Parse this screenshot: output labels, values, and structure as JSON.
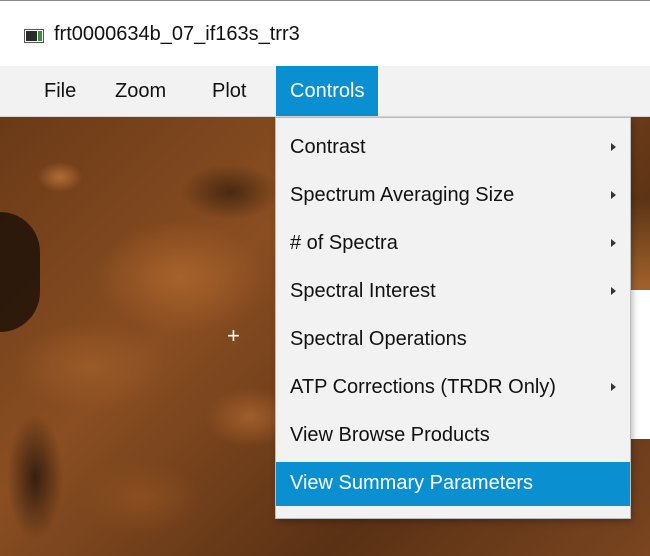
{
  "window": {
    "title": "frt0000634b_07_if163s_trr3",
    "icon": "window-app-icon"
  },
  "menubar": {
    "items": [
      {
        "label": "File"
      },
      {
        "label": "Zoom"
      },
      {
        "label": "Plot"
      },
      {
        "label": "Controls"
      }
    ],
    "active": "Controls",
    "accent_color": "#0a90d0"
  },
  "controls_menu": {
    "items": [
      {
        "label": "Contrast",
        "has_submenu": true
      },
      {
        "label": "Spectrum Averaging Size",
        "has_submenu": true
      },
      {
        "label": "# of Spectra",
        "has_submenu": true
      },
      {
        "label": "Spectral Interest",
        "has_submenu": true
      },
      {
        "label": "Spectral Operations",
        "has_submenu": false
      },
      {
        "label": "ATP Corrections (TRDR Only)",
        "has_submenu": true
      },
      {
        "label": "View Browse Products",
        "has_submenu": false
      },
      {
        "label": "View Summary Parameters",
        "has_submenu": false,
        "highlighted": true
      }
    ]
  },
  "image_view": {
    "crosshair_icon": "plus-crosshair-icon",
    "scroll_icon": "chevron-down-icon"
  }
}
